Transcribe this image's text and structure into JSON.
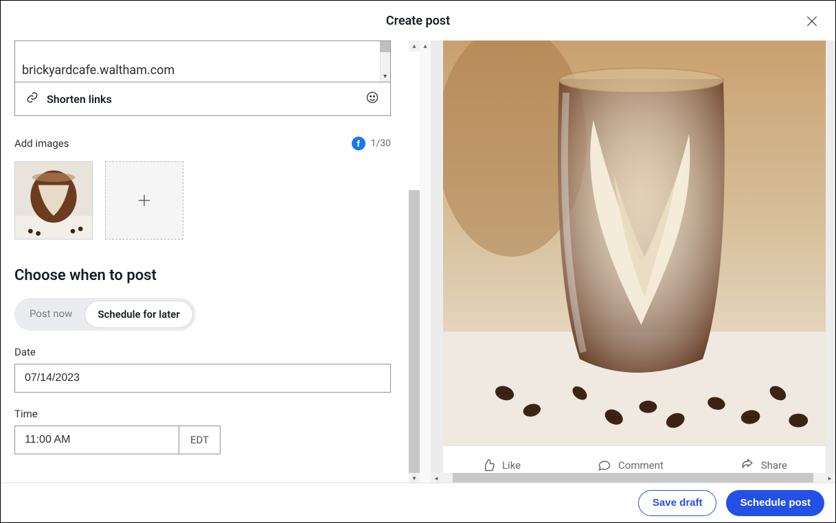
{
  "header": {
    "title": "Create post"
  },
  "composer": {
    "link_text": "brickyardcafe.waltham.com",
    "shorten_label": "Shorten links"
  },
  "images": {
    "label": "Add images",
    "counter": "1/30",
    "platform_icon_letter": "f"
  },
  "scheduling": {
    "heading": "Choose when to post",
    "options": {
      "post_now": "Post now",
      "schedule_later": "Schedule for later"
    },
    "date_label": "Date",
    "date_value": "07/14/2023",
    "time_label": "Time",
    "time_value": "11:00 AM",
    "timezone": "EDT"
  },
  "preview_actions": {
    "like": "Like",
    "comment": "Comment",
    "share": "Share"
  },
  "footer": {
    "save_draft": "Save draft",
    "schedule_post": "Schedule post"
  }
}
